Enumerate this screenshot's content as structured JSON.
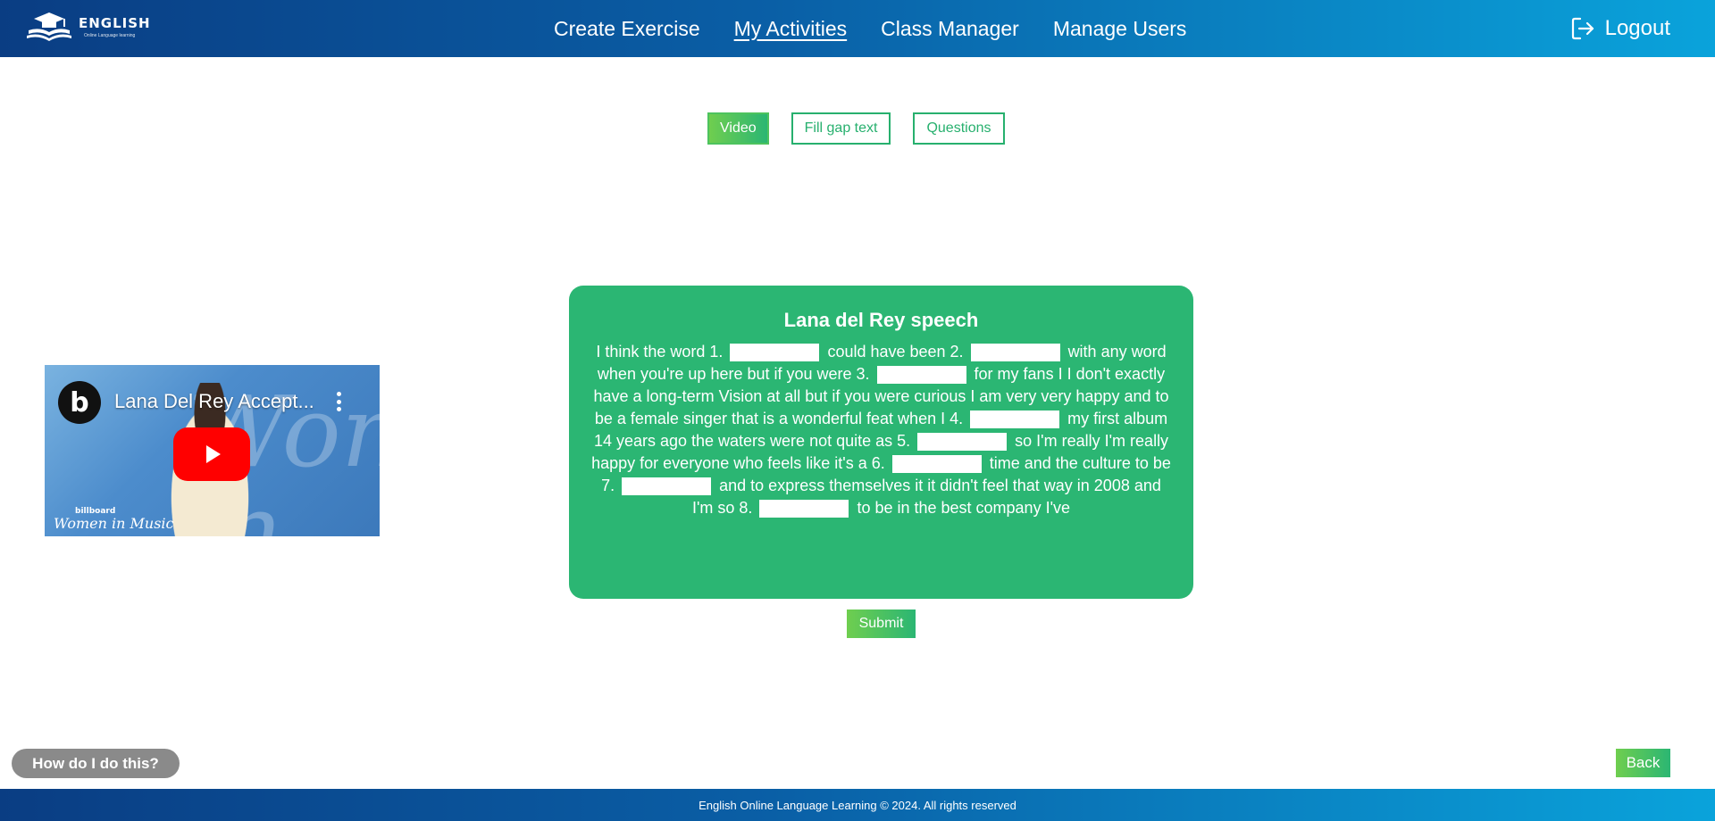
{
  "header": {
    "logo_title": "ENGLISH",
    "logo_subtitle": "Online Language learning",
    "nav": [
      {
        "label": "Create Exercise"
      },
      {
        "label": "My Activities",
        "active": true
      },
      {
        "label": "Class Manager"
      },
      {
        "label": "Manage Users"
      }
    ],
    "logout_label": "Logout"
  },
  "tabs": [
    {
      "label": "Video",
      "active": true
    },
    {
      "label": "Fill gap text"
    },
    {
      "label": "Questions"
    }
  ],
  "video": {
    "title": "Lana Del Rey Accept...",
    "channel_initial": "b",
    "watermark_brand": "billboard",
    "watermark_text": "Women in Music",
    "background_text": "Women in Music"
  },
  "exercise": {
    "title": "Lana del Rey speech",
    "segments": [
      "I think the word 1.",
      "could have been 2.",
      "with any word when you're up here but if you were 3.",
      "for my fans I I don't exactly have a long-term Vision at all but if you were curious I am very very happy and to be a female singer that is a wonderful feat when I 4.",
      "my first album 14 years ago the waters were not quite as 5.",
      "so I'm really I'm really happy for everyone who feels like it's a 6.",
      "time and the culture to be 7.",
      "and to express themselves it it didn't feel that way in 2008 and I'm so 8.",
      "to be in the best company I've"
    ]
  },
  "submit_label": "Submit",
  "help_label": "How do I do this?",
  "back_label": "Back",
  "footer_text": "English Online Language Learning © 2024. All rights reserved",
  "colors": {
    "header_start": "#0a3d83",
    "header_end": "#0aa3db",
    "accent_green": "#2bb673",
    "accent_light_green": "#6fce4f",
    "help_grey": "#8a8a8a",
    "youtube_red": "#ff0000"
  }
}
